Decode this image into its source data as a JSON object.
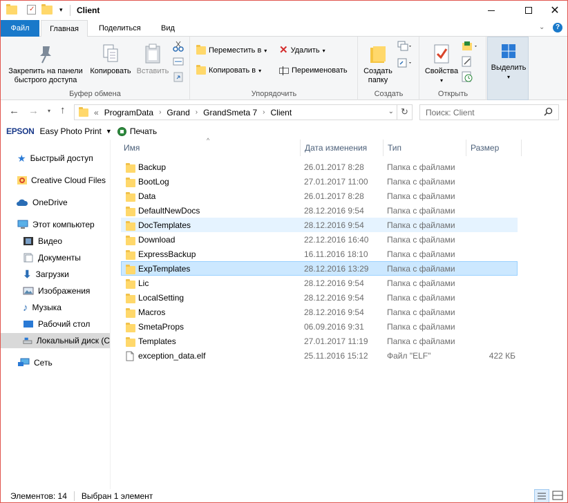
{
  "window": {
    "title": "Client",
    "minimize": "—",
    "maximize": "☐",
    "close": "✕"
  },
  "ribbon_tabs": [
    "Файл",
    "Главная",
    "Поделиться",
    "Вид"
  ],
  "ribbon": {
    "clipboard": {
      "label": "Буфер обмена",
      "pin": "Закрепить на панели быстрого доступа",
      "pin_line1": "Закрепить на панели",
      "pin_line2": "быстрого доступа",
      "copy": "Копировать",
      "paste": "Вставить"
    },
    "organize": {
      "label": "Упорядочить",
      "move": "Переместить в",
      "copy_to": "Копировать в",
      "delete": "Удалить",
      "rename": "Переименовать"
    },
    "create": {
      "label": "Создать",
      "new_folder_line1": "Создать",
      "new_folder_line2": "папку"
    },
    "open": {
      "label": "Открыть",
      "properties": "Свойства"
    },
    "select": {
      "label": "Выделить"
    }
  },
  "address": {
    "prefix": "«",
    "crumbs": [
      "ProgramData",
      "Grand",
      "GrandSmeta 7",
      "Client"
    ],
    "search_placeholder": "Поиск: Client"
  },
  "epson": {
    "brand": "EPSON",
    "app": "Easy Photo Print",
    "print": "Печать"
  },
  "nav": [
    {
      "label": "Быстрый доступ",
      "icon": "star-icon"
    },
    {
      "label": "Creative Cloud Files",
      "icon": "creative-cloud-icon"
    },
    {
      "label": "OneDrive",
      "icon": "cloud-icon"
    },
    {
      "label": "Этот компьютер",
      "icon": "computer-icon"
    },
    {
      "label": "Видео",
      "icon": "video-icon"
    },
    {
      "label": "Документы",
      "icon": "documents-icon"
    },
    {
      "label": "Загрузки",
      "icon": "download-icon"
    },
    {
      "label": "Изображения",
      "icon": "images-icon"
    },
    {
      "label": "Музыка",
      "icon": "music-icon"
    },
    {
      "label": "Рабочий стол",
      "icon": "desktop-icon"
    },
    {
      "label": "Локальный диск (C",
      "icon": "drive-icon"
    },
    {
      "label": "Сеть",
      "icon": "network-icon"
    }
  ],
  "columns": [
    "Имя",
    "Дата изменения",
    "Тип",
    "Размер"
  ],
  "files": [
    {
      "name": "Backup",
      "date": "26.01.2017 8:28",
      "type": "Папка с файлами",
      "size": ""
    },
    {
      "name": "BootLog",
      "date": "27.01.2017 11:00",
      "type": "Папка с файлами",
      "size": ""
    },
    {
      "name": "Data",
      "date": "26.01.2017 8:28",
      "type": "Папка с файлами",
      "size": ""
    },
    {
      "name": "DefaultNewDocs",
      "date": "28.12.2016 9:54",
      "type": "Папка с файлами",
      "size": ""
    },
    {
      "name": "DocTemplates",
      "date": "28.12.2016 9:54",
      "type": "Папка с файлами",
      "size": ""
    },
    {
      "name": "Download",
      "date": "22.12.2016 16:40",
      "type": "Папка с файлами",
      "size": ""
    },
    {
      "name": "ExpressBackup",
      "date": "16.11.2016 18:10",
      "type": "Папка с файлами",
      "size": ""
    },
    {
      "name": "ExpTemplates",
      "date": "28.12.2016 13:29",
      "type": "Папка с файлами",
      "size": ""
    },
    {
      "name": "Lic",
      "date": "28.12.2016 9:54",
      "type": "Папка с файлами",
      "size": ""
    },
    {
      "name": "LocalSetting",
      "date": "28.12.2016 9:54",
      "type": "Папка с файлами",
      "size": ""
    },
    {
      "name": "Macros",
      "date": "28.12.2016 9:54",
      "type": "Папка с файлами",
      "size": ""
    },
    {
      "name": "SmetaProps",
      "date": "06.09.2016 9:31",
      "type": "Папка с файлами",
      "size": ""
    },
    {
      "name": "Templates",
      "date": "27.01.2017 11:19",
      "type": "Папка с файлами",
      "size": ""
    },
    {
      "name": "exception_data.elf",
      "date": "25.11.2016 15:12",
      "type": "Файл \"ELF\"",
      "size": "422 КБ"
    }
  ],
  "status": {
    "count": "Элементов: 14",
    "selected": "Выбран 1 элемент"
  },
  "colors": {
    "accent": "#1979ca",
    "selected_bg": "#cce8ff",
    "hover_bg": "#e5f3ff",
    "folder": "#ffd86b"
  }
}
